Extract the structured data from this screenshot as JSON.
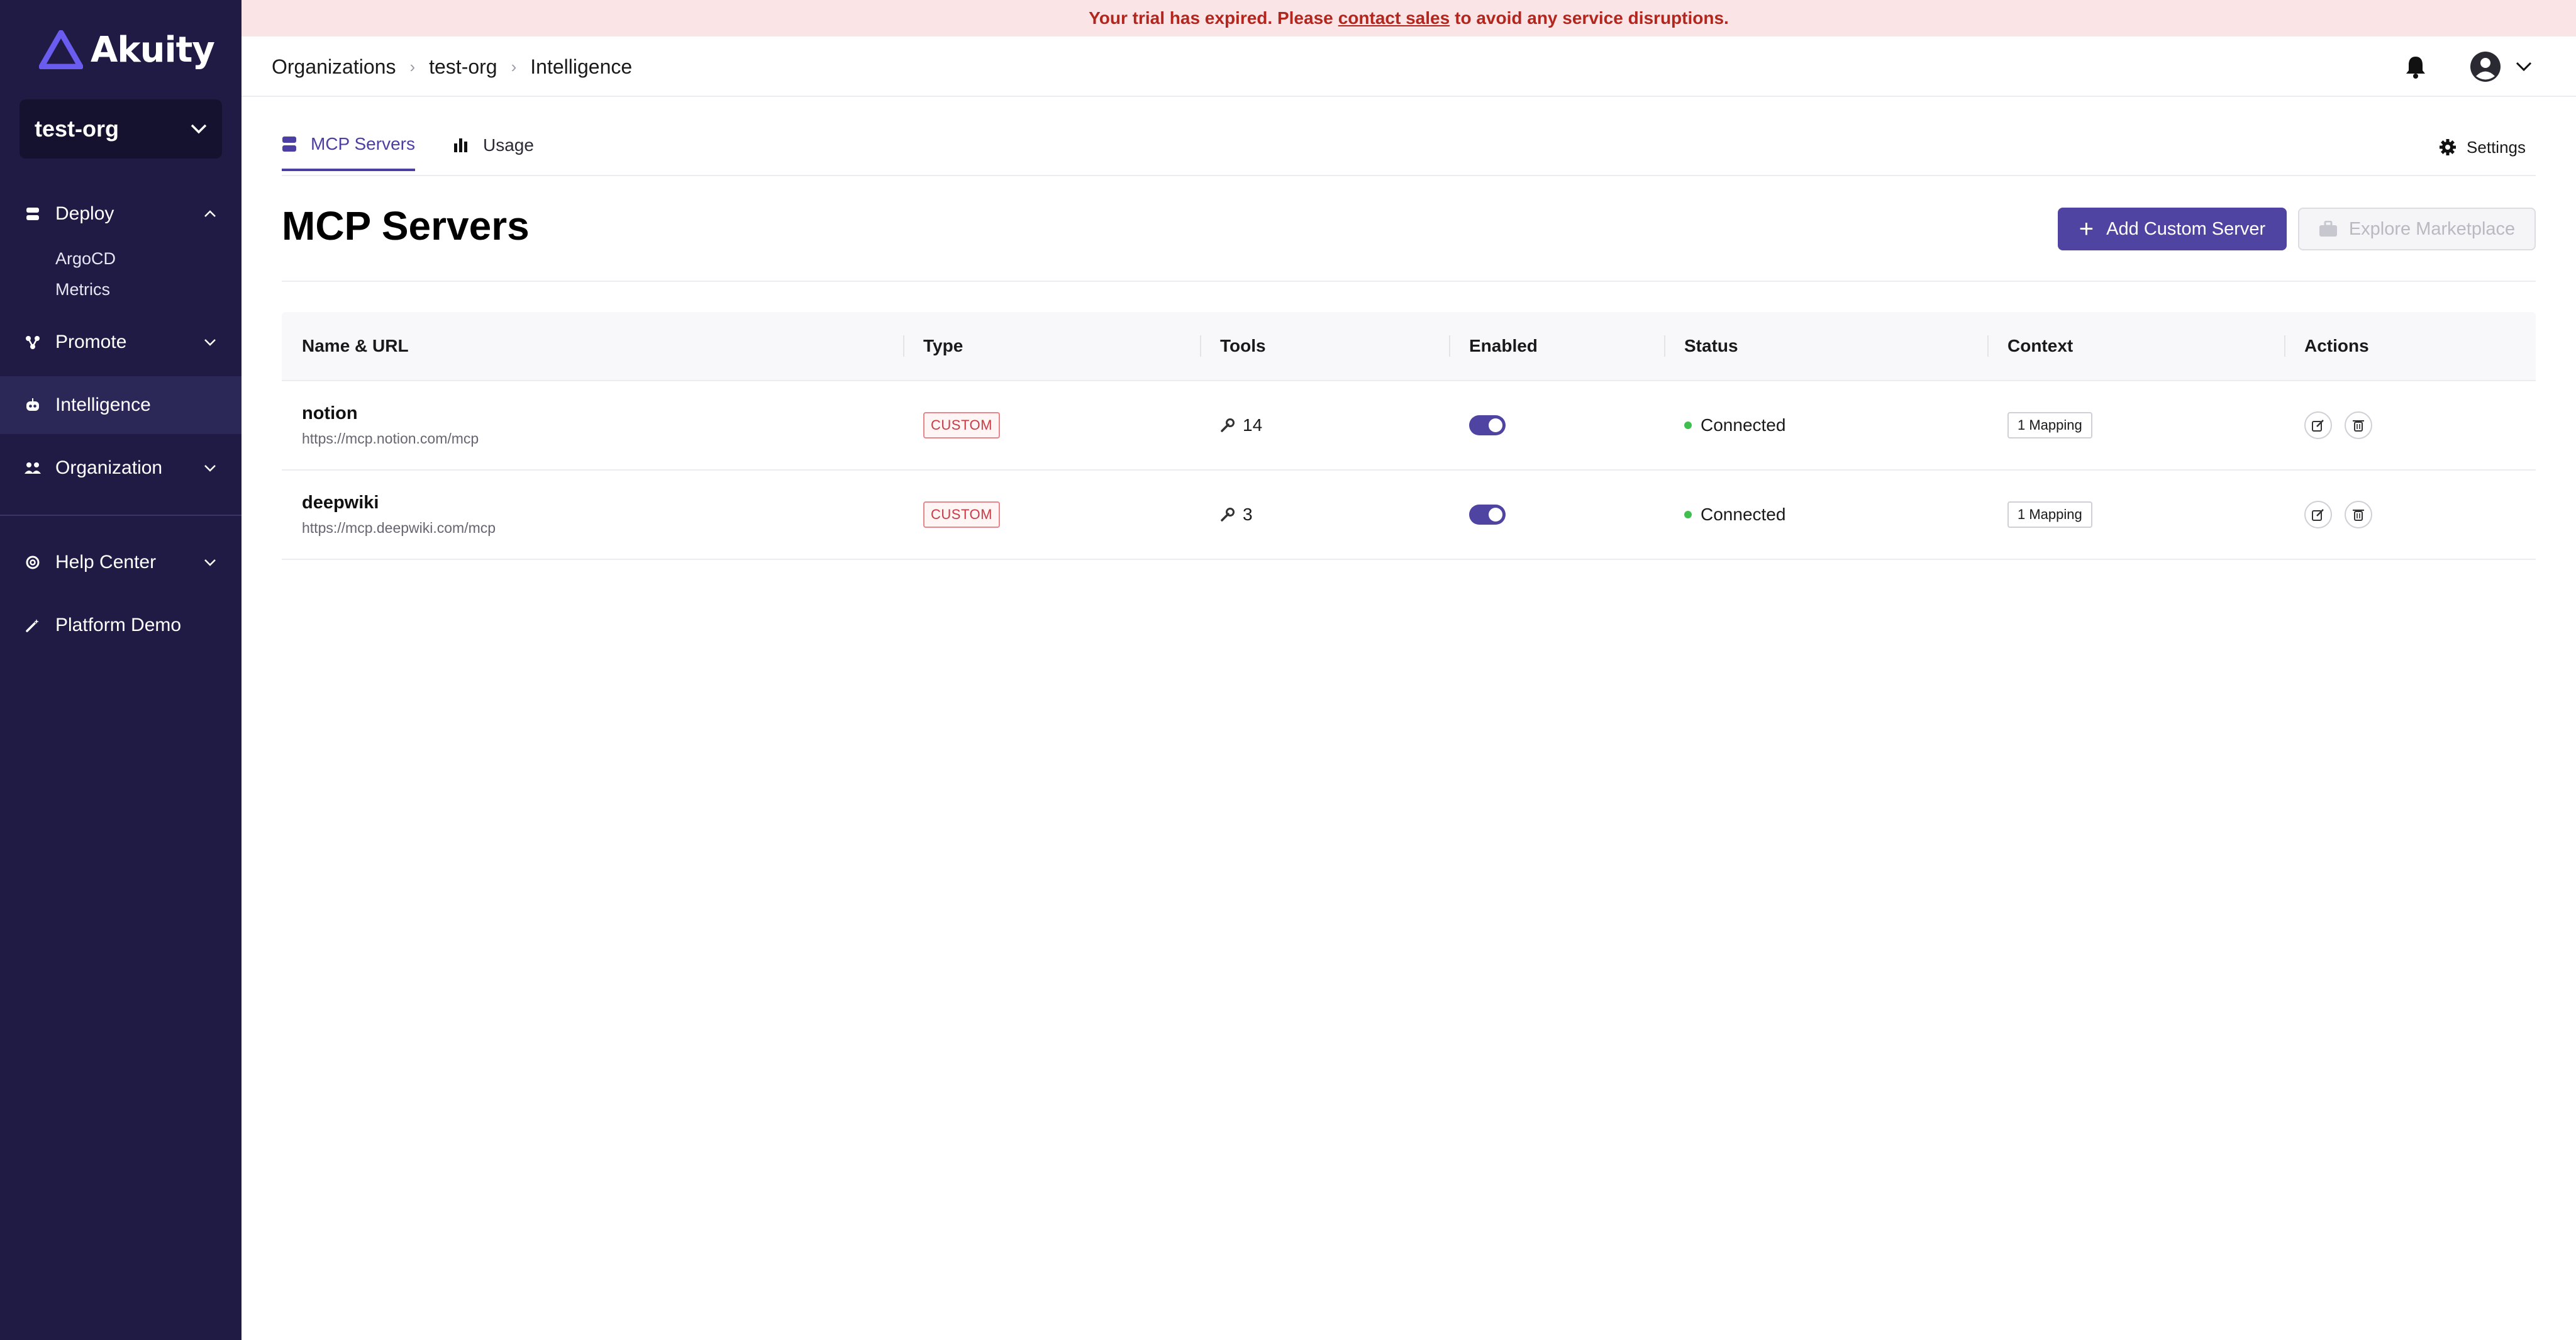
{
  "app": {
    "name": "Akuity"
  },
  "banner": {
    "prefix": "Your trial has expired. Please",
    "link": "contact sales",
    "suffix": "to avoid any service disruptions."
  },
  "sidebar": {
    "org": "test-org",
    "deploy": {
      "label": "Deploy",
      "sub": [
        "ArgoCD",
        "Metrics"
      ]
    },
    "promote": "Promote",
    "intelligence": "Intelligence",
    "organization": "Organization",
    "help": "Help Center",
    "demo": "Platform Demo"
  },
  "breadcrumb": [
    "Organizations",
    "test-org",
    "Intelligence"
  ],
  "tabs": {
    "mcp": "MCP Servers",
    "usage": "Usage",
    "settings": "Settings"
  },
  "page": {
    "title": "MCP Servers",
    "add_button": "Add Custom Server",
    "marketplace_button": "Explore Marketplace"
  },
  "table": {
    "headers": [
      "Name & URL",
      "Type",
      "Tools",
      "Enabled",
      "Status",
      "Context",
      "Actions"
    ],
    "rows": [
      {
        "name": "notion",
        "url": "https://mcp.notion.com/mcp",
        "type": "CUSTOM",
        "tools": "14",
        "enabled": true,
        "status": "Connected",
        "context": "1 Mapping"
      },
      {
        "name": "deepwiki",
        "url": "https://mcp.deepwiki.com/mcp",
        "type": "CUSTOM",
        "tools": "3",
        "enabled": true,
        "status": "Connected",
        "context": "1 Mapping"
      }
    ]
  },
  "colors": {
    "sidebar": "#1f1b45",
    "accent": "#4f44a1",
    "banner_bg": "#fbe4e6",
    "banner_text": "#b3261e",
    "status_ok": "#3fbf4f"
  }
}
